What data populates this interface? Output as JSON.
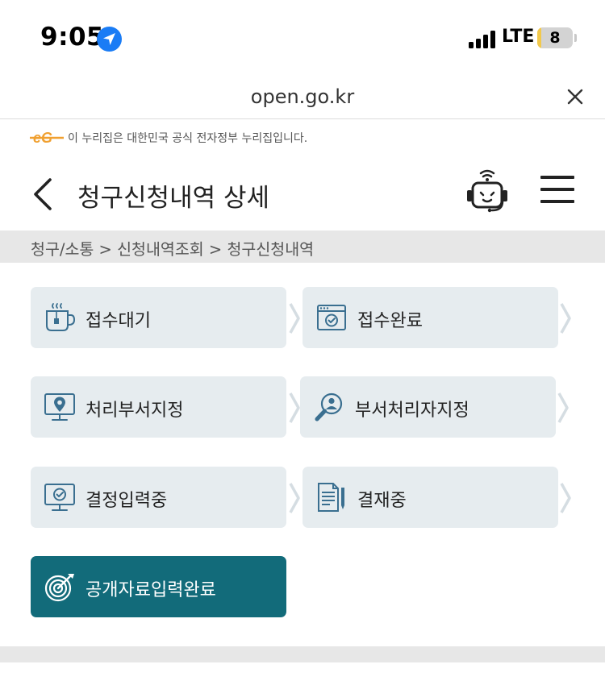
{
  "status_bar": {
    "time": "9:05",
    "network": "LTE",
    "battery": "8",
    "battery_level": 0.08
  },
  "browser": {
    "url": "open.go.kr",
    "close_icon": "close-icon"
  },
  "gov_banner": {
    "logo_text": "eG",
    "text": "이 누리집은 대한민국 공식 전자정부 누리집입니다."
  },
  "header": {
    "title": "청구신청내역 상세",
    "back_icon": "chevron-left-icon",
    "chatbot_icon": "chatbot-icon",
    "menu_icon": "hamburger-menu-icon"
  },
  "breadcrumb": {
    "text": "청구/소통 > 신청내역조회 > 청구신청내역"
  },
  "colors": {
    "accent": "#126b7a",
    "icon_blue": "#3a6f90",
    "step_bg": "#e6ecef",
    "breadcrumb_bg": "#e7e7e7",
    "gov_logo": "#f0a030"
  },
  "steps": [
    {
      "label": "접수대기",
      "icon": "tea-cup-icon",
      "active": false
    },
    {
      "label": "접수완료",
      "icon": "browser-check-icon",
      "active": false
    },
    {
      "label": "처리부서지정",
      "icon": "monitor-location-icon",
      "active": false
    },
    {
      "label": "부서처리자지정",
      "icon": "search-person-icon",
      "active": false
    },
    {
      "label": "결정입력중",
      "icon": "monitor-check-icon",
      "active": false
    },
    {
      "label": "결재중",
      "icon": "document-pen-icon",
      "active": false
    },
    {
      "label": "공개자료입력완료",
      "icon": "target-icon",
      "active": true
    }
  ]
}
